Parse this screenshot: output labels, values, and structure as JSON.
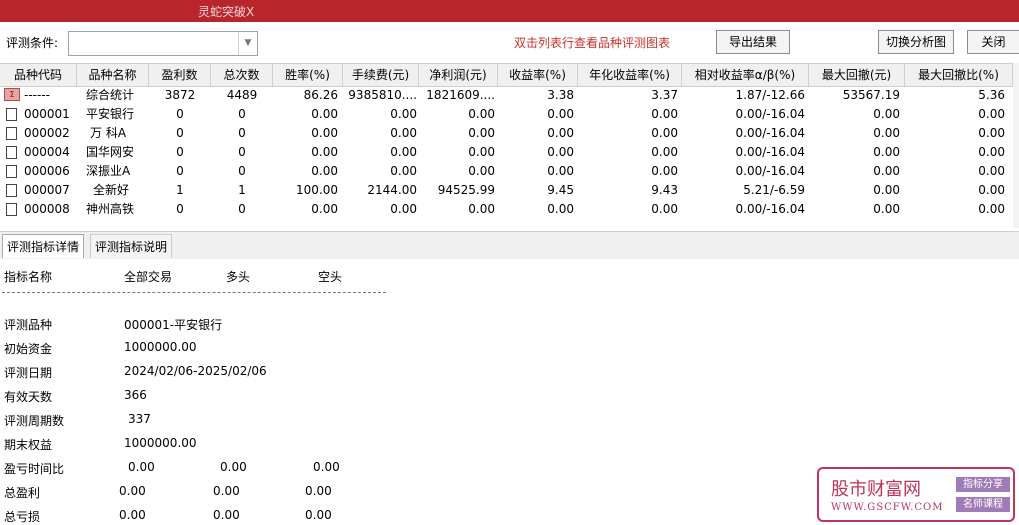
{
  "window": {
    "title": "灵蛇突破X"
  },
  "toolbar": {
    "condition_label": "评测条件:",
    "condition_value": "",
    "hint": "双击列表行查看品种评测图表",
    "export_label": "导出结果",
    "switch_label": "切换分析图",
    "close_label": "关闭"
  },
  "grid": {
    "headers": [
      "品种代码",
      "品种名称",
      "盈利数",
      "总次数",
      "胜率(%)",
      "手续费(元)",
      "净利润(元)",
      "收益率(%)",
      "年化收益率(%)",
      "相对收益率α/β(%)",
      "最大回撤(元)",
      "最大回撤比(%)"
    ],
    "rows": [
      {
        "code": "------",
        "name": "综合统计",
        "win": "3872",
        "total": "4489",
        "rate": "86.26",
        "fee": "9385810....",
        "profit": "1821609....",
        "ret": "3.38",
        "annual": "3.37",
        "rel": "1.87/-12.66",
        "dd": "53567.19",
        "ddr": "5.36",
        "summary": true
      },
      {
        "code": "000001",
        "name": "平安银行",
        "win": "0",
        "total": "0",
        "rate": "0.00",
        "fee": "0.00",
        "profit": "0.00",
        "ret": "0.00",
        "annual": "0.00",
        "rel": "0.00/-16.04",
        "dd": "0.00",
        "ddr": "0.00",
        "summary": false
      },
      {
        "code": "000002",
        "name": "万 科A",
        "win": "0",
        "total": "0",
        "rate": "0.00",
        "fee": "0.00",
        "profit": "0.00",
        "ret": "0.00",
        "annual": "0.00",
        "rel": "0.00/-16.04",
        "dd": "0.00",
        "ddr": "0.00",
        "summary": false
      },
      {
        "code": "000004",
        "name": "国华网安",
        "win": "0",
        "total": "0",
        "rate": "0.00",
        "fee": "0.00",
        "profit": "0.00",
        "ret": "0.00",
        "annual": "0.00",
        "rel": "0.00/-16.04",
        "dd": "0.00",
        "ddr": "0.00",
        "summary": false
      },
      {
        "code": "000006",
        "name": "深振业A",
        "win": "0",
        "total": "0",
        "rate": "0.00",
        "fee": "0.00",
        "profit": "0.00",
        "ret": "0.00",
        "annual": "0.00",
        "rel": "0.00/-16.04",
        "dd": "0.00",
        "ddr": "0.00",
        "summary": false
      },
      {
        "code": "000007",
        "name": "全新好",
        "win": "1",
        "total": "1",
        "rate": "100.00",
        "fee": "2144.00",
        "profit": "94525.99",
        "ret": "9.45",
        "annual": "9.43",
        "rel": "5.21/-6.59",
        "dd": "0.00",
        "ddr": "0.00",
        "summary": false
      },
      {
        "code": "000008",
        "name": "神州高铁",
        "win": "0",
        "total": "0",
        "rate": "0.00",
        "fee": "0.00",
        "profit": "0.00",
        "ret": "0.00",
        "annual": "0.00",
        "rel": "0.00/-16.04",
        "dd": "0.00",
        "ddr": "0.00",
        "summary": false
      }
    ]
  },
  "tabs": {
    "detail": "评测指标详情",
    "explain": "评测指标说明"
  },
  "detail": {
    "header": {
      "name": "指标名称",
      "all": "全部交易",
      "long": "多头",
      "short": "空头"
    },
    "dashes": "----------------------------------------------------------------------",
    "items": [
      {
        "label": "评测品种",
        "v1": "000001-平安银行"
      },
      {
        "label": "初始资金",
        "v1": "1000000.00"
      },
      {
        "label": "评测日期",
        "v1": "2024/02/06-2025/02/06"
      },
      {
        "label": "有效天数",
        "v1": "366"
      },
      {
        "label": "评测周期数",
        "v1": "337"
      },
      {
        "label": "期末权益",
        "v1": "1000000.00"
      },
      {
        "label": "盈亏时间比",
        "v1": "0.00",
        "v2": "0.00",
        "v3": "0.00"
      },
      {
        "label": "总盈利",
        "v1": "0.00",
        "v2": "0.00",
        "v3": "0.00"
      },
      {
        "label": "总亏损",
        "v1": "0.00",
        "v2": "0.00",
        "v3": "0.00"
      }
    ]
  },
  "watermark": {
    "main": "股市财富网",
    "url": "WWW.GSCFW.COM",
    "tag1": "指标分享",
    "tag2": "名师课程"
  }
}
